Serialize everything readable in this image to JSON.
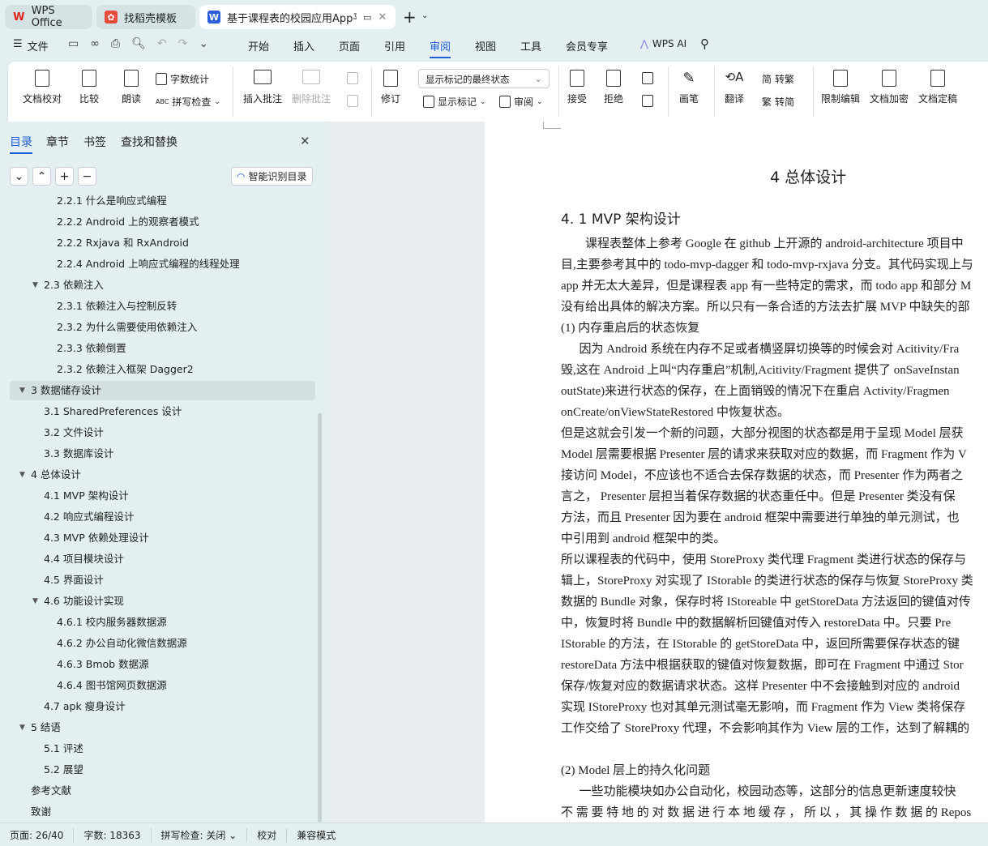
{
  "tabs": [
    {
      "label": "WPS Office",
      "icon": "wps-logo"
    },
    {
      "label": "找稻壳模板",
      "icon": "docer-logo"
    },
    {
      "label": "基于课程表的校园应用App平台",
      "icon": "word-logo"
    }
  ],
  "quick": {
    "file": "文件"
  },
  "menu": [
    "开始",
    "插入",
    "页面",
    "引用",
    "审阅",
    "视图",
    "工具",
    "会员专享"
  ],
  "menu_active": "审阅",
  "wps_ai": "WPS AI",
  "ribbon": {
    "proof": "文档校对",
    "compare": "比较",
    "read": "朗读",
    "wordcount": "字数统计",
    "spell": "拼写检查",
    "insert_comment": "插入批注",
    "delete_comment": "删除批注",
    "track": "修订",
    "markup_select": "显示标记的最终状态",
    "show_markup": "显示标记",
    "review_pane": "审阅",
    "accept": "接受",
    "reject": "拒绝",
    "pen": "画笔",
    "translate": "翻译",
    "to_trad": "转繁",
    "to_simp": "转简",
    "restrict": "限制编辑",
    "encrypt": "文档加密",
    "finalize": "文档定稿"
  },
  "panel": {
    "tabs": [
      "目录",
      "章节",
      "书签",
      "查找和替换"
    ],
    "smart_toc": "智能识别目录"
  },
  "toc": [
    {
      "label": "2.2.1 什么是响应式编程",
      "level": 3
    },
    {
      "label": "2.2.2 Android 上的观察者模式",
      "level": 3
    },
    {
      "label": "2.2.2 Rxjava 和 RxAndroid",
      "level": 3
    },
    {
      "label": "2.2.4 Android 上响应式编程的线程处理",
      "level": 3
    },
    {
      "label": "2.3 依赖注入",
      "level": 2,
      "expanded": true
    },
    {
      "label": "2.3.1 依赖注入与控制反转",
      "level": 3
    },
    {
      "label": "2.3.2 为什么需要使用依赖注入",
      "level": 3
    },
    {
      "label": "2.3.3  依赖倒置",
      "level": 3
    },
    {
      "label": "2.3.2  依赖注入框架 Dagger2",
      "level": 3
    },
    {
      "label": "3  数据储存设计",
      "level": 1,
      "expanded": true,
      "selected": true
    },
    {
      "label": "3.1 SharedPreferences 设计",
      "level": 2
    },
    {
      "label": "3.2  文件设计",
      "level": 2
    },
    {
      "label": "3.3  数据库设计",
      "level": 2
    },
    {
      "label": "4  总体设计",
      "level": 1,
      "expanded": true
    },
    {
      "label": "4.1 MVP 架构设计",
      "level": 2
    },
    {
      "label": "4.2  响应式编程设计",
      "level": 2
    },
    {
      "label": "4.3 MVP 依赖处理设计",
      "level": 2
    },
    {
      "label": "4.4  项目模块设计",
      "level": 2
    },
    {
      "label": "4.5  界面设计",
      "level": 2
    },
    {
      "label": "4.6  功能设计实现",
      "level": 2,
      "expanded": true
    },
    {
      "label": "4.6.1 校内服务器数据源",
      "level": 3
    },
    {
      "label": "4.6.2  办公自动化微信数据源",
      "level": 3
    },
    {
      "label": "4.6.3 Bmob 数据源",
      "level": 3
    },
    {
      "label": "4.6.4  图书馆网页数据源",
      "level": 3
    },
    {
      "label": "4.7 apk 瘦身设计",
      "level": 2
    },
    {
      "label": "5  结语",
      "level": 1,
      "expanded": true
    },
    {
      "label": "5.1  评述",
      "level": 2
    },
    {
      "label": "5.2  展望",
      "level": 2
    },
    {
      "label": "参考文献",
      "level": 1
    },
    {
      "label": "致谢",
      "level": 1
    }
  ],
  "doc": {
    "chapter": "4  总体设计",
    "section": "4. 1  MVP 架构设计",
    "lines": [
      {
        "t": "课程表整体上参考 Google 在 github 上开源的 android-architecture 项目中",
        "ind": 2
      },
      {
        "t": "目,主要参考其中的 todo-mvp-dagger 和 todo-mvp-rxjava 分支。其代码实现上与"
      },
      {
        "t": "app 并无太大差异，但是课程表 app 有一些特定的需求，而 todo app 和部分 M"
      },
      {
        "t": "没有给出具体的解决方案。所以只有一条合适的方法去扩展 MVP 中缺失的部"
      },
      {
        "t": "(1) 内存重启后的状态恢复"
      },
      {
        "t": "因为 Android 系统在内存不足或者横竖屏切换等的时候会对 Acitivity/Fra",
        "ind": 1.5
      },
      {
        "t": "毁,这在 Android 上叫“内存重启”机制,Acitivity/Fragment 提供了 onSaveInstan"
      },
      {
        "t": "outState)来进行状态的保存，在上面销毁的情况下在重启 Activity/Fragmen"
      },
      {
        "t": "onCreate/onViewStateRestored 中恢复状态。"
      },
      {
        "t": "但是这就会引发一个新的问题，大部分视图的状态都是用于呈现 Model 层获"
      },
      {
        "t": "Model 层需要根据 Presenter 层的请求来获取对应的数据，而 Fragment 作为 V"
      },
      {
        "t": "接访问 Model，不应该也不适合去保存数据的状态，而 Presenter 作为两者之"
      },
      {
        "t": "言之，  Presenter 层担当着保存数据的状态重任中。但是 Presenter 类没有保"
      },
      {
        "t": "方法，而且 Presenter 因为要在 android 框架中需要进行单独的单元测试，也"
      },
      {
        "t": "中引用到 android 框架中的类。"
      },
      {
        "t": "所以课程表的代码中，使用 StoreProxy 类代理 Fragment 类进行状态的保存与"
      },
      {
        "t": "辑上，StoreProxy 对实现了 IStorable 的类进行状态的保存与恢复 StoreProxy 类"
      },
      {
        "t": "数据的 Bundle 对象，保存时将 IStoreable 中 getStoreData 方法返回的键值对传"
      },
      {
        "t": "中，恢复时将 Bundle 中的数据解析回键值对传入 restoreData 中。只要 Pre"
      },
      {
        "t": "IStorable 的方法，在 IStorable 的 getStoreData 中，返回所需要保存状态的键"
      },
      {
        "t": "restoreData 方法中根据获取的键值对恢复数据，即可在 Fragment 中通过 Stor"
      },
      {
        "t": "保存/恢复对应的数据请求状态。这样 Presenter 中不会接触到对应的 android"
      },
      {
        "t": "实现 IStoreProxy 也对其单元测试毫无影响，而 Fragment 作为 View 类将保存"
      },
      {
        "t": "工作交给了 StoreProxy 代理，不会影响其作为 View 层的工作，达到了解耦的"
      },
      {
        "t": ""
      },
      {
        "t": "(2) Model 层上的持久化问题"
      },
      {
        "t": "一些功能模块如办公自动化，校园动态等，这部分的信息更新速度较快",
        "ind": 1.5
      },
      {
        "t": "不 需 要 特 地 的 对 数 据 进 行 本 地 缓 存 ， 所 以 ， 其 操 作 数 据 的  Repos"
      }
    ]
  },
  "status": {
    "page": "页面: 26/40",
    "words": "字数: 18363",
    "spell": "拼写检查: 关闭",
    "proof": "校对",
    "compat": "兼容模式"
  },
  "colors": {
    "accent": "#1f5fd6",
    "wps_red": "#e2231a",
    "word_blue": "#2b5fd9"
  }
}
